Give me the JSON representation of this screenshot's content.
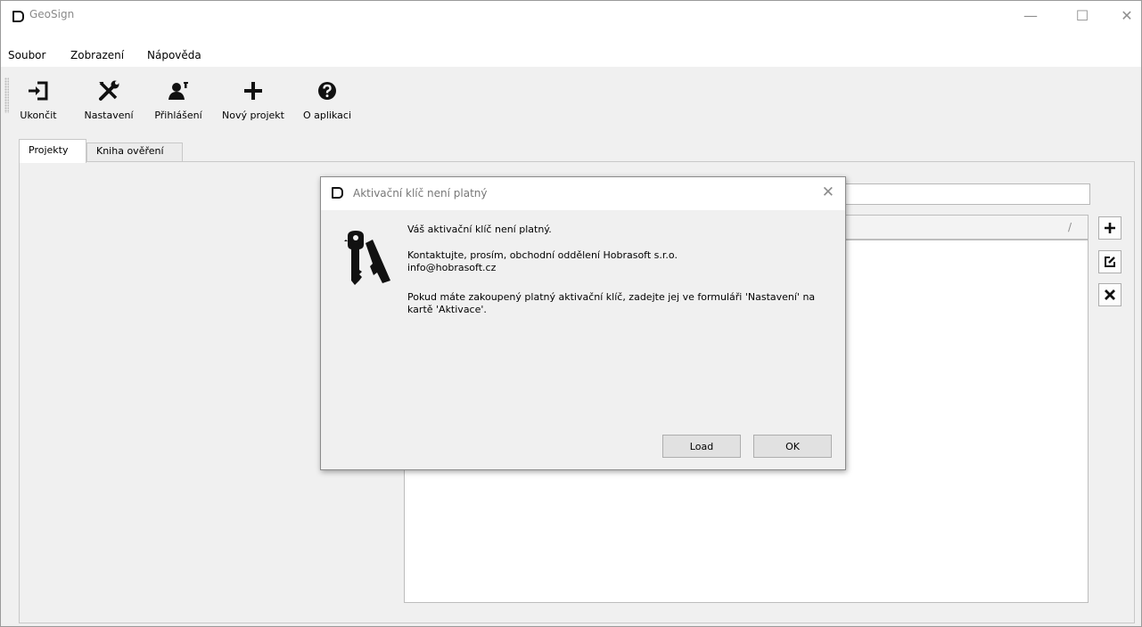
{
  "window": {
    "title": "GeoSign"
  },
  "window_controls": {
    "minimize": "—",
    "maximize": "☐",
    "close": "✕"
  },
  "menu": [
    "Soubor",
    "Zobrazení",
    "Nápověda"
  ],
  "toolbar": [
    {
      "label": "Ukončit",
      "icon": "exit-icon"
    },
    {
      "label": "Nastavení",
      "icon": "tools-icon"
    },
    {
      "label": "Přihlášení",
      "icon": "user-icon"
    },
    {
      "label": "Nový projekt",
      "icon": "plus-icon"
    },
    {
      "label": "O aplikaci",
      "icon": "help-icon"
    }
  ],
  "tabs": [
    "Projekty",
    "Kniha ověření"
  ],
  "list": {
    "sort_indicator": "/"
  },
  "side_buttons": [
    {
      "icon": "plus-icon"
    },
    {
      "icon": "edit-icon"
    },
    {
      "icon": "delete-icon"
    }
  ],
  "dialog": {
    "title": "Aktivační klíč není platný",
    "close": "✕",
    "line1": "Váš aktivační klíč není platný.",
    "line2": "Kontaktujte, prosím, obchodní oddělení Hobrasoft s.r.o.",
    "line3": "info@hobrasoft.cz",
    "line4": "Pokud máte zakoupený platný aktivační klíč, zadejte jej ve formuláři 'Nastavení' na",
    "line5": "kartě 'Aktivace'.",
    "load_label": "Load",
    "ok_label": "OK"
  }
}
